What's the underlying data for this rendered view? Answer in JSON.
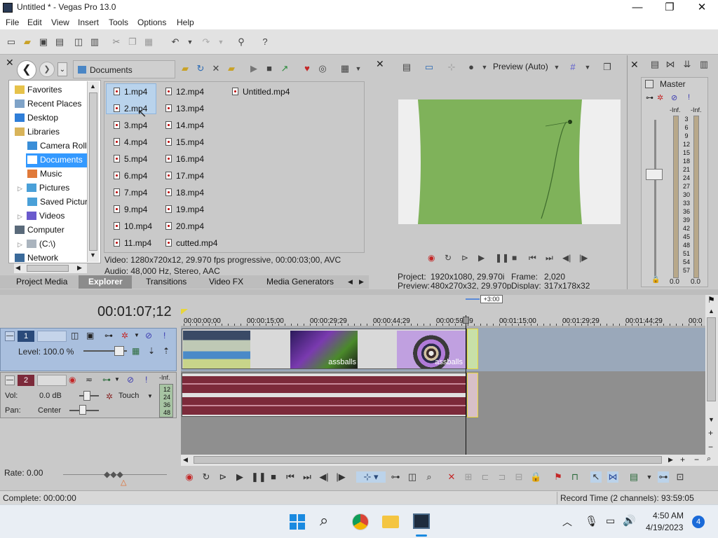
{
  "window": {
    "title": "Untitled * - Vegas Pro 13.0",
    "minimize": "—",
    "maximize": "❐",
    "close": "✕"
  },
  "menu": [
    "File",
    "Edit",
    "View",
    "Insert",
    "Tools",
    "Options",
    "Help"
  ],
  "explorer": {
    "path": "Documents",
    "tree": [
      {
        "label": "Favorites",
        "icon": "star-folder-icon"
      },
      {
        "label": "Recent Places",
        "icon": "recent-places-icon"
      },
      {
        "label": "Desktop",
        "icon": "desktop-icon"
      },
      {
        "label": "Libraries",
        "icon": "libraries-icon"
      },
      {
        "label": "Camera Roll",
        "icon": "camera-roll-icon"
      },
      {
        "label": "Documents",
        "icon": "documents-icon",
        "selected": true
      },
      {
        "label": "Music",
        "icon": "music-icon"
      },
      {
        "label": "Pictures",
        "icon": "pictures-icon"
      },
      {
        "label": "Saved Pictur",
        "icon": "saved-pictures-icon"
      },
      {
        "label": "Videos",
        "icon": "videos-icon"
      },
      {
        "label": "Computer",
        "icon": "computer-icon"
      },
      {
        "label": "(C:\\)",
        "icon": "drive-icon"
      },
      {
        "label": "Network",
        "icon": "network-icon"
      }
    ],
    "files_col1": [
      "1.mp4",
      "2.mp4",
      "3.mp4",
      "4.mp4",
      "5.mp4",
      "6.mp4",
      "7.mp4",
      "9.mp4",
      "10.mp4",
      "11.mp4"
    ],
    "files_col2": [
      "12.mp4",
      "13.mp4",
      "14.mp4",
      "15.mp4",
      "16.mp4",
      "17.mp4",
      "18.mp4",
      "19.mp4",
      "20.mp4",
      "cutted.mp4"
    ],
    "files_col3": [
      "Untitled.mp4"
    ],
    "info_video": "Video: 1280x720x12, 29.970 fps progressive, 00:00:03;00, AVC",
    "info_audio": "Audio: 48,000 Hz, Stereo, AAC"
  },
  "tabs": [
    "Project Media",
    "Explorer",
    "Transitions",
    "Video FX",
    "Media Generators"
  ],
  "active_tab": "Explorer",
  "preview": {
    "mode": "Preview (Auto)",
    "project_label": "Project:",
    "project_value": "1920x1080, 29.970i",
    "preview_label": "Preview:",
    "preview_value": "480x270x32, 29.970p",
    "frame_label": "Frame:",
    "frame_value": "2,020",
    "display_label": "Display:",
    "display_value": "317x178x32"
  },
  "mixer": {
    "title": "Master",
    "inf_left": "-Inf.",
    "inf_right": "-Inf.",
    "scale": [
      "3",
      "6",
      "9",
      "12",
      "15",
      "18",
      "21",
      "24",
      "27",
      "30",
      "33",
      "36",
      "39",
      "42",
      "45",
      "48",
      "51",
      "54",
      "57"
    ],
    "bottom_left": "0.0",
    "bottom_right": "0.0"
  },
  "timeline": {
    "timecode": "00:01:07;12",
    "offset": "+3:00",
    "ruler": [
      "00:00:00;00",
      "00:00:15;00",
      "00:00:29;29",
      "00:00:44;29",
      "00:00:59;29",
      "00:01:15;00",
      "00:01:29;29",
      "00:01:44;29",
      "00:0"
    ],
    "track1": {
      "number": "1",
      "level_label": "Level: 100.0 %"
    },
    "track2": {
      "number": "2",
      "vol_label": "Vol:",
      "vol_value": "0.0 dB",
      "pan_label": "Pan:",
      "pan_value": "Center",
      "touch": "Touch",
      "meter_inf": "-Inf.",
      "meter_scale": [
        "12",
        "24",
        "36",
        "48"
      ]
    },
    "clip_labels": [
      "assballs",
      "assballs"
    ],
    "rate": "Rate: 0.00"
  },
  "status": {
    "complete": "Complete: 00:00:00",
    "record_time": "Record Time (2 channels): 93:59:05"
  },
  "taskbar": {
    "time": "4:50 AM",
    "date": "4/19/2023",
    "badge": "4"
  },
  "colors": {
    "accent": "#3399ff",
    "video_track": "#a9bfde",
    "audio_track": "#c4c4c4",
    "waveform": "#7c2a3a",
    "timeline_bg": "#8f8f8f"
  }
}
